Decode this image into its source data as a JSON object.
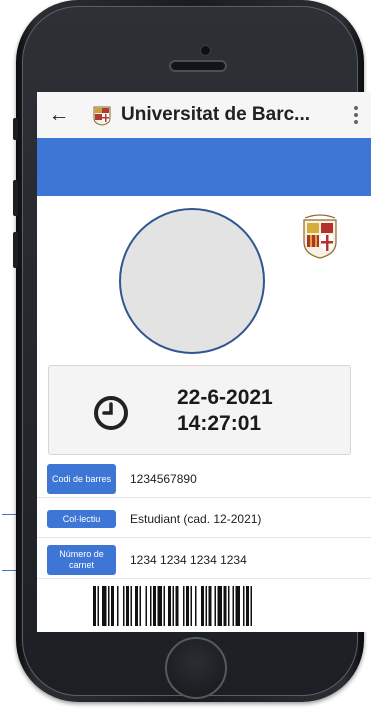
{
  "appbar": {
    "back_icon": "arrow-back-icon",
    "title": "Universitat de Barc...",
    "menu_icon": "more-vertical-icon"
  },
  "profile": {
    "photo": "profile-photo-placeholder",
    "crest_icon": "university-crest-icon"
  },
  "clock": {
    "icon": "clock-icon",
    "date": "22-6-2021",
    "time": "14:27:01"
  },
  "fields": [
    {
      "label": "Codi de barres",
      "value": "1234567890"
    },
    {
      "label": "Col·lectiu",
      "value": "Estudiant (cad. 12-2021)"
    },
    {
      "label": "Número de carnet",
      "value": "1234 1234 1234 1234"
    }
  ],
  "colors": {
    "accent": "#3e76d6",
    "frame": "#1c1f23",
    "card": "#f4f4f4"
  }
}
